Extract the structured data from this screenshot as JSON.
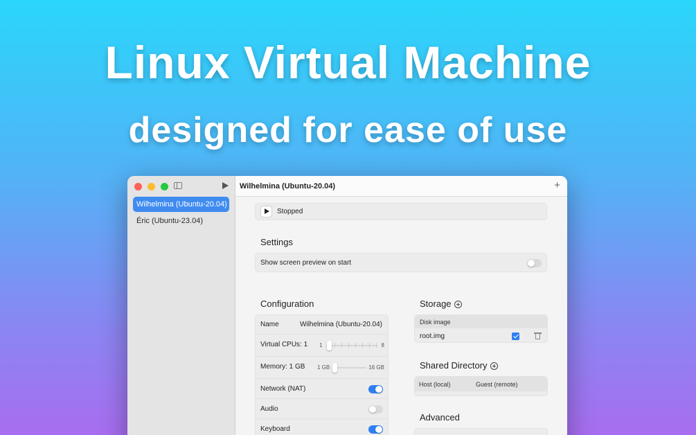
{
  "hero": {
    "title": "Linux Virtual Machine",
    "subtitle": "designed for ease of use"
  },
  "window": {
    "title": "Wilhelmina (Ubuntu-20.04)",
    "add_icon": "plus-icon"
  },
  "sidebar": {
    "items": [
      {
        "label": "Wilhelmina (Ubuntu-20.04)",
        "selected": true
      },
      {
        "label": "Éric (Ubuntu-23.04)",
        "selected": false
      }
    ]
  },
  "status": {
    "text": "Stopped"
  },
  "settings": {
    "title": "Settings",
    "preview_label": "Show screen preview on start",
    "preview_on": false
  },
  "configuration": {
    "title": "Configuration",
    "name_label": "Name",
    "name_value": "Wilhelmina (Ubuntu-20.04)",
    "cpus_label": "Virtual CPUs: 1",
    "cpus_min": "1",
    "cpus_max": "8",
    "memory_label": "Memory: 1 GB",
    "memory_min": "1 GB",
    "memory_max": "16 GB",
    "network_label": "Network (NAT)",
    "network_on": true,
    "audio_label": "Audio",
    "audio_on": false,
    "keyboard_label": "Keyboard",
    "keyboard_on": true
  },
  "storage": {
    "title": "Storage",
    "header": "Disk image",
    "disk_name": "root.img",
    "disk_checked": true
  },
  "shared_directory": {
    "title": "Shared Directory",
    "host_header": "Host (local)",
    "guest_header": "Guest (remote)"
  },
  "advanced": {
    "title": "Advanced"
  },
  "colors": {
    "accent": "#2f7ff2",
    "selection": "#3f8bf0"
  }
}
